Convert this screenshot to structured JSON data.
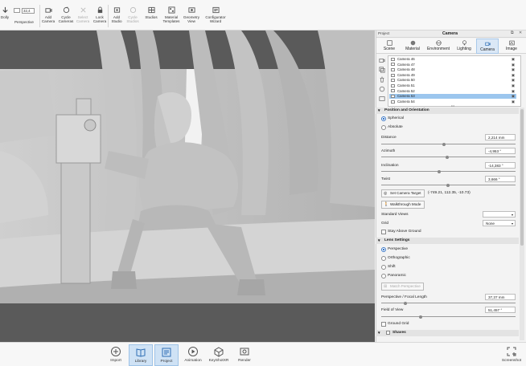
{
  "toolbar": {
    "dolly": "Dolly",
    "perspective": "Perspective",
    "focal_value": "32,4",
    "buttons": [
      {
        "label": "Add\nCamera",
        "icon": "add-camera-icon"
      },
      {
        "label": "Cycle\nCameras",
        "icon": "cycle-cameras-icon"
      },
      {
        "label": "Select\nCamera",
        "icon": "select-camera-icon"
      },
      {
        "label": "Lock\nCamera",
        "icon": "lock-camera-icon"
      },
      {
        "label": "Add\nStudio",
        "icon": "add-studio-icon"
      },
      {
        "label": "Cycle\nStudios",
        "icon": "cycle-studios-icon"
      },
      {
        "label": "Studios",
        "icon": "studios-icon"
      },
      {
        "label": "Material\nTemplates",
        "icon": "material-templates-icon"
      },
      {
        "label": "Geometry\nView",
        "icon": "geometry-view-icon"
      },
      {
        "label": "Configurator\nWizard",
        "icon": "configurator-wizard-icon"
      }
    ]
  },
  "panel": {
    "project_label": "Project",
    "title": "Camera",
    "tabs": [
      "Scene",
      "Material",
      "Environment",
      "Lighting",
      "Camera",
      "Image"
    ],
    "active_tab": "Camera",
    "cameras": [
      "Camera 46",
      "Camera 47",
      "Camera 48",
      "Camera 49",
      "Camera 50",
      "Camera 51",
      "Camera 52",
      "Camera 53",
      "Camera 54"
    ],
    "selected_camera": "Camera 53",
    "position_section": "Position and Orientation",
    "spherical": "Spherical",
    "absolute": "Absolute",
    "distance_label": "Distance",
    "distance_value": "2,214 mm",
    "azimuth_label": "Azimuth",
    "azimuth_value": "-4,953 °",
    "inclination_label": "Inclination",
    "inclination_value": "-14,383 °",
    "twist_label": "Twist",
    "twist_value": "3,666 °",
    "set_target_label": "Set Camera Target",
    "target_coords": "(-749.21, 112.35, -10.73)",
    "walkthrough_label": "Walkthrough Mode",
    "standard_views_label": "Standard Views",
    "standard_views_value": "",
    "grid_label": "Grid",
    "grid_value": "None",
    "stay_above_ground": "Stay Above Ground",
    "lens_section": "Lens Settings",
    "lens_perspective": "Perspective",
    "lens_orthographic": "Orthographic",
    "lens_shift": "Shift",
    "lens_panoramic": "Panoramic",
    "match_perspective": "Match Perspective",
    "focal_label": "Perspective / Focal Length",
    "focal_value": "37,37 mm",
    "fov_label": "Field of View",
    "fov_value": "51,457 °",
    "ground_grid": "Ground Grid",
    "shaves_section": "Shaves"
  },
  "bottom": {
    "buttons": [
      {
        "label": "Import",
        "icon": "import-icon"
      },
      {
        "label": "Library",
        "icon": "library-icon"
      },
      {
        "label": "Project",
        "icon": "project-icon"
      },
      {
        "label": "Animation",
        "icon": "animation-icon"
      },
      {
        "label": "KeyShotXR",
        "icon": "keyshotxr-icon"
      },
      {
        "label": "Render",
        "icon": "render-icon"
      }
    ],
    "screenshot": "Screenshot"
  },
  "colors": {
    "accent": "#3a78c8",
    "selection": "#9cc6ee",
    "viewport_bg": "#5a5a5a"
  }
}
